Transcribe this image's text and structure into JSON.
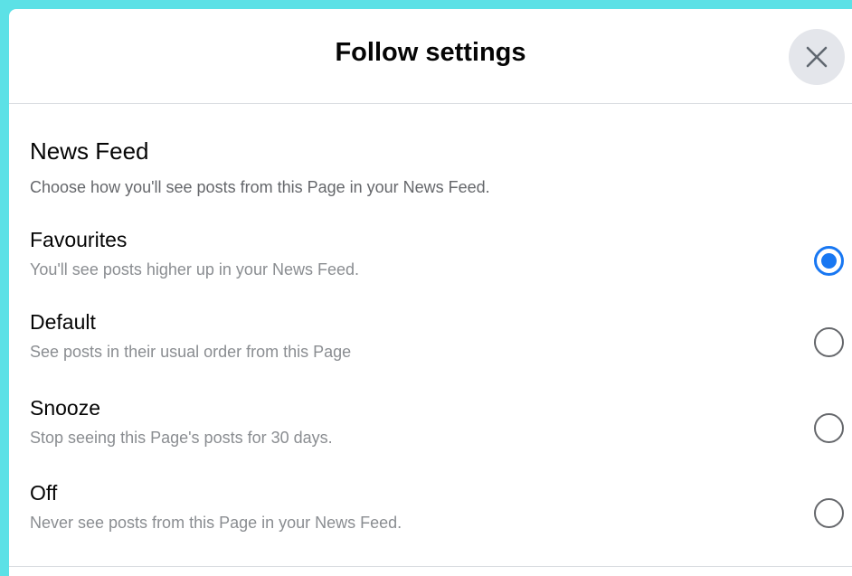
{
  "dialog": {
    "title": "Follow settings",
    "close_icon": "close-icon"
  },
  "section": {
    "title": "News Feed",
    "description": "Choose how you'll see posts from this Page in your News Feed."
  },
  "options": [
    {
      "label": "Favourites",
      "description": "You'll see posts higher up in your News Feed.",
      "selected": true
    },
    {
      "label": "Default",
      "description": "See posts in their usual order from this Page",
      "selected": false
    },
    {
      "label": "Snooze",
      "description": "Stop seeing this Page's posts for 30 days.",
      "selected": false
    },
    {
      "label": "Off",
      "description": "Never see posts from this Page in your News Feed.",
      "selected": false
    }
  ],
  "colors": {
    "background": "#5ce1e6",
    "accent": "#1877f2",
    "secondary_text": "#65676b"
  }
}
